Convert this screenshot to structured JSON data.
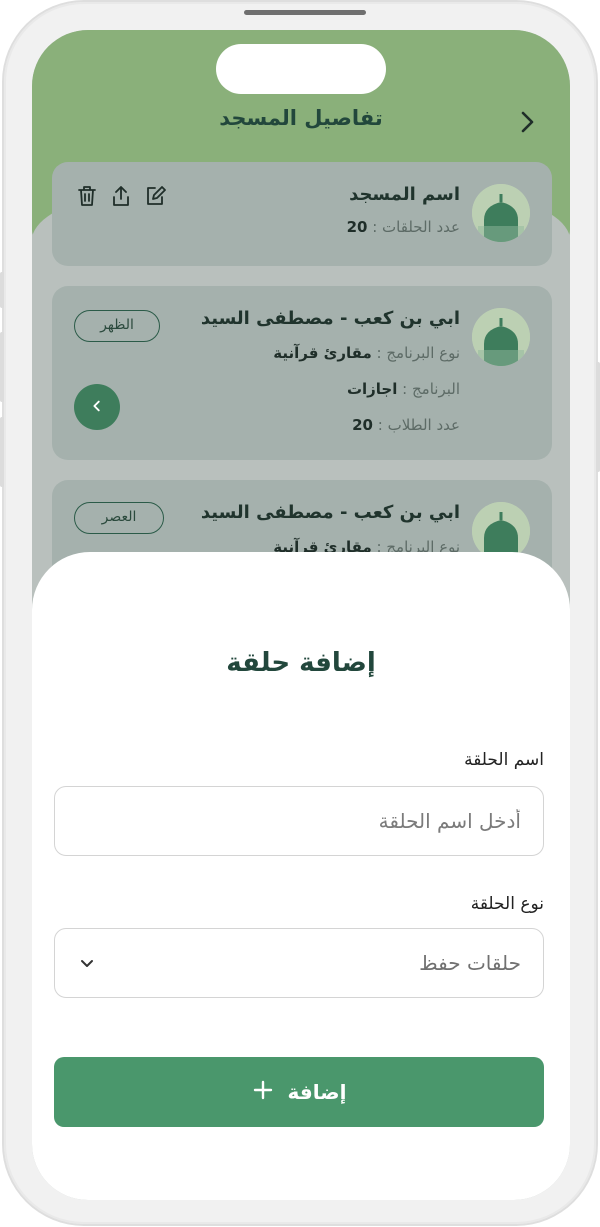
{
  "header": {
    "title": "تفاصيل المسجد"
  },
  "mosque": {
    "name": "اسم المسجد",
    "circles_label": "عدد الحلقات :",
    "circles_count": "20"
  },
  "circles": [
    {
      "title": "ابي بن كعب - مصطفى السيد",
      "time": "الظهر",
      "program_type_label": "نوع البرنامج :",
      "program_type": "مقارئ قرآنية",
      "program_label": "البرنامج :",
      "program": "اجازات",
      "students_label": "عدد الطلاب :",
      "students": "20"
    },
    {
      "title": "ابي بن كعب - مصطفى السيد",
      "time": "العصر",
      "program_type_label": "نوع البرنامج :",
      "program_type": "مقارئ قرآنية"
    }
  ],
  "sheet": {
    "title": "إضافة حلقة",
    "name_label": "اسم الحلقة",
    "name_placeholder": "أدخل اسم الحلقة",
    "type_label": "نوع الحلقة",
    "type_value": "حلقات حفظ",
    "submit_label": "إضافة"
  },
  "colors": {
    "header": "#8ab07a",
    "primary": "#4a976c",
    "title": "#22473c"
  },
  "icons": [
    "chevron-right-icon",
    "edit-icon",
    "share-icon",
    "trash-icon",
    "mosque-icon",
    "chevron-left-icon",
    "chevron-down-icon",
    "plus-icon"
  ]
}
